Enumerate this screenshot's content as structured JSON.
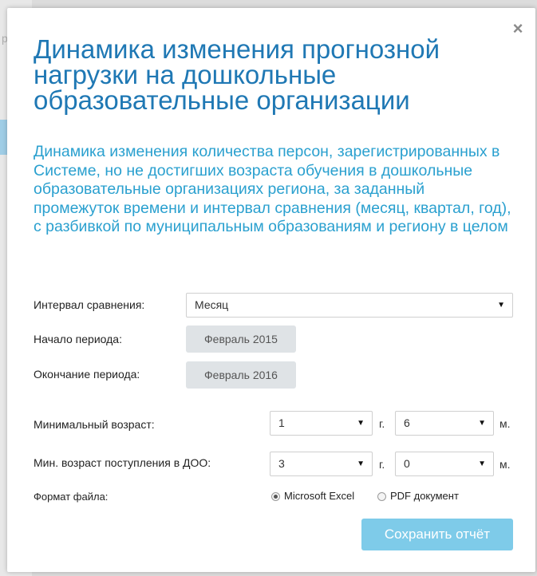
{
  "backdrop": {
    "letter": "р"
  },
  "modal": {
    "close_icon": "×",
    "title": "Динамика изменения прогнозной нагрузки на дошкольные образовательные организации",
    "subtitle": "Динамика изменения количества персон, зарегистрированных в Системе, но не достигших возраста обучения в дошкольные образовательные организациях региона, за заданный промежуток времени и интервал сравнения (месяц, квартал, год), с разбивкой по муниципальным образованиям и региону в целом"
  },
  "form": {
    "interval": {
      "label": "Интервал сравнения:",
      "value": "Месяц"
    },
    "period_start": {
      "label": "Начало периода:",
      "value": "Февраль 2015"
    },
    "period_end": {
      "label": "Окончание периода:",
      "value": "Февраль 2016"
    },
    "min_age": {
      "label": "Минимальный возраст:",
      "years": "1",
      "years_unit": "г.",
      "months": "6",
      "months_unit": "м."
    },
    "min_admission_age": {
      "label": "Мин. возраст поступления в ДОО:",
      "years": "3",
      "years_unit": "г.",
      "months": "0",
      "months_unit": "м."
    },
    "file_format": {
      "label": "Формат файла:",
      "options": [
        "Microsoft Excel",
        "PDF документ"
      ],
      "selected": "Microsoft Excel"
    },
    "save_label": "Сохранить отчёт"
  },
  "icons": {
    "dropdown": "▼",
    "close": "close-icon"
  }
}
